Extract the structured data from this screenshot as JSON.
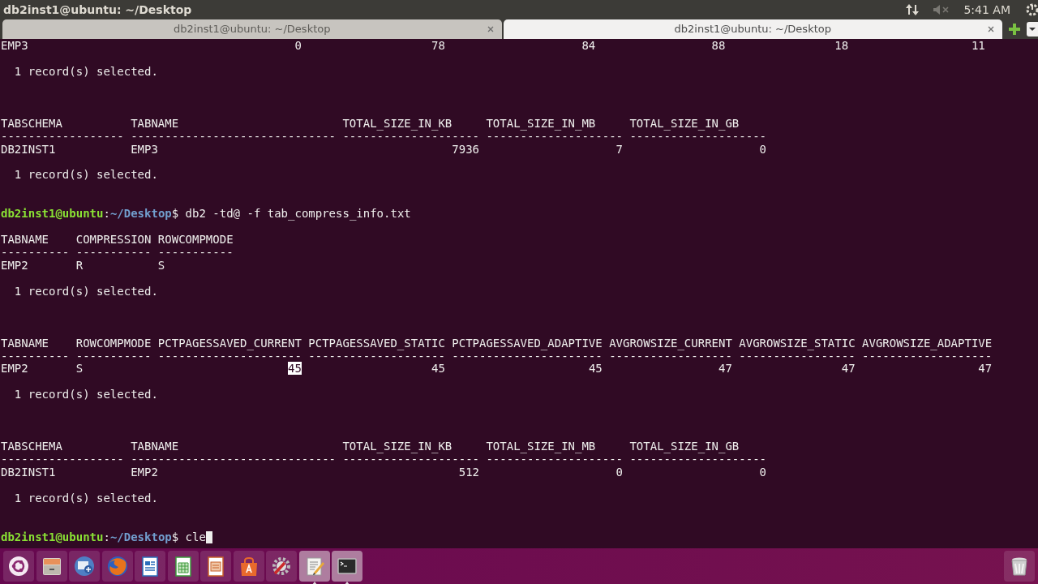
{
  "top_panel": {
    "title": "db2inst1@ubuntu: ~/Desktop",
    "clock": "5:41 AM"
  },
  "tabs": [
    {
      "label": "db2inst1@ubuntu: ~/Desktop",
      "selected": false
    },
    {
      "label": "db2inst1@ubuntu: ~/Desktop",
      "selected": true
    }
  ],
  "terminal_lines": [
    {
      "kind": "output",
      "text": "EMP3                                       0                   78                    84                 88                18                  11"
    },
    {
      "kind": "blank"
    },
    {
      "kind": "output",
      "text": "  1 record(s) selected."
    },
    {
      "kind": "blank"
    },
    {
      "kind": "blank"
    },
    {
      "kind": "blank"
    },
    {
      "kind": "output",
      "text": "TABSCHEMA          TABNAME                        TOTAL_SIZE_IN_KB     TOTAL_SIZE_IN_MB     TOTAL_SIZE_IN_GB"
    },
    {
      "kind": "output",
      "text": "------------------ ------------------------------ -------------------- -------------------- --------------------"
    },
    {
      "kind": "output",
      "text": "DB2INST1           EMP3                                           7936                    7                    0"
    },
    {
      "kind": "blank"
    },
    {
      "kind": "output",
      "text": "  1 record(s) selected."
    },
    {
      "kind": "blank"
    },
    {
      "kind": "blank"
    },
    {
      "kind": "prompt",
      "user": "db2inst1@ubuntu",
      "separator": ":",
      "path": "~/Desktop",
      "symbol": "$",
      "command": "db2 -td@ -f tab_compress_info.txt",
      "cursor": false
    },
    {
      "kind": "blank"
    },
    {
      "kind": "output",
      "text": "TABNAME    COMPRESSION ROWCOMPMODE"
    },
    {
      "kind": "output",
      "text": "---------- ----------- -----------"
    },
    {
      "kind": "output",
      "text": "EMP2       R           S"
    },
    {
      "kind": "blank"
    },
    {
      "kind": "output",
      "text": "  1 record(s) selected."
    },
    {
      "kind": "blank"
    },
    {
      "kind": "blank"
    },
    {
      "kind": "blank"
    },
    {
      "kind": "output",
      "text": "TABNAME    ROWCOMPMODE PCTPAGESSAVED_CURRENT PCTPAGESSAVED_STATIC PCTPAGESSAVED_ADAPTIVE AVGROWSIZE_CURRENT AVGROWSIZE_STATIC AVGROWSIZE_ADAPTIVE"
    },
    {
      "kind": "output",
      "text": "---------- ----------- --------------------- -------------------- ---------------------- ------------------ ----------------- -------------------"
    },
    {
      "kind": "output",
      "segments": [
        {
          "text": "EMP2       S                              ",
          "selected": false
        },
        {
          "text": "45",
          "selected": true
        },
        {
          "text": "                   45                     45                 47                47                  47",
          "selected": false
        }
      ]
    },
    {
      "kind": "blank"
    },
    {
      "kind": "output",
      "text": "  1 record(s) selected."
    },
    {
      "kind": "blank"
    },
    {
      "kind": "blank"
    },
    {
      "kind": "blank"
    },
    {
      "kind": "output",
      "text": "TABSCHEMA          TABNAME                        TOTAL_SIZE_IN_KB     TOTAL_SIZE_IN_MB     TOTAL_SIZE_IN_GB"
    },
    {
      "kind": "output",
      "text": "------------------ ------------------------------ -------------------- -------------------- --------------------"
    },
    {
      "kind": "output",
      "text": "DB2INST1           EMP2                                            512                    0                    0"
    },
    {
      "kind": "blank"
    },
    {
      "kind": "output",
      "text": "  1 record(s) selected."
    },
    {
      "kind": "blank"
    },
    {
      "kind": "blank"
    },
    {
      "kind": "prompt",
      "user": "db2inst1@ubuntu",
      "separator": ":",
      "path": "~/Desktop",
      "symbol": "$",
      "command": "cle",
      "cursor": true
    }
  ],
  "dock": [
    {
      "kind": "ubuntu",
      "running": false
    },
    {
      "kind": "files",
      "running": false
    },
    {
      "kind": "network",
      "running": false
    },
    {
      "kind": "browser",
      "running": false
    },
    {
      "kind": "writer",
      "running": false
    },
    {
      "kind": "calc",
      "running": false
    },
    {
      "kind": "impress",
      "running": false
    },
    {
      "kind": "store",
      "running": false
    },
    {
      "kind": "settings",
      "running": false
    },
    {
      "kind": "editor",
      "running": true
    },
    {
      "kind": "terminal",
      "running": true
    },
    {
      "kind": "trash",
      "running": false
    }
  ]
}
